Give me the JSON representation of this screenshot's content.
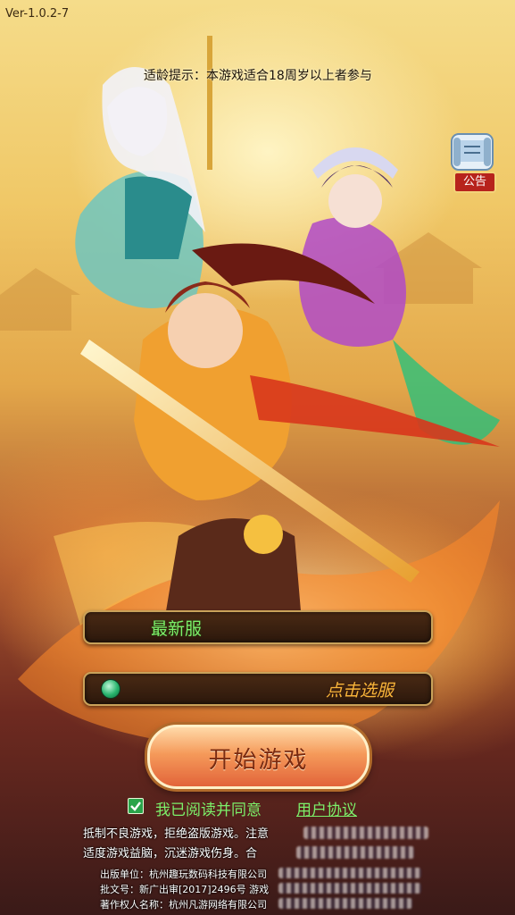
{
  "version": "Ver-1.0.2-7",
  "age_tip": "适龄提示：本游戏适合18周岁以上者参与",
  "notice": {
    "label": "公告",
    "icon": "scroll-icon"
  },
  "servers": {
    "latest_label": "最新服",
    "select_label": "点击选服",
    "status_icon": "server-status-dot-icon"
  },
  "start_button": {
    "label": "开始游戏"
  },
  "agreement": {
    "text": "我已阅读并同意",
    "link": "用户协议",
    "checked": true
  },
  "health_notice": {
    "line1": "抵制不良游戏，拒绝盗版游戏。注意",
    "line2": "适度游戏益脑，沉迷游戏伤身。合"
  },
  "publisher": {
    "unit": "出版单位：杭州趣玩数码科技有限公司",
    "approval": "批文号：新广出审[2017]2496号  游戏",
    "copyright": "著作权人名称：杭州凡游网络有限公司"
  },
  "colors": {
    "accent_green": "#7cf06a",
    "select_orange": "#f7b43a",
    "button_orange": "#e2643a",
    "notice_red": "#b7231c"
  }
}
